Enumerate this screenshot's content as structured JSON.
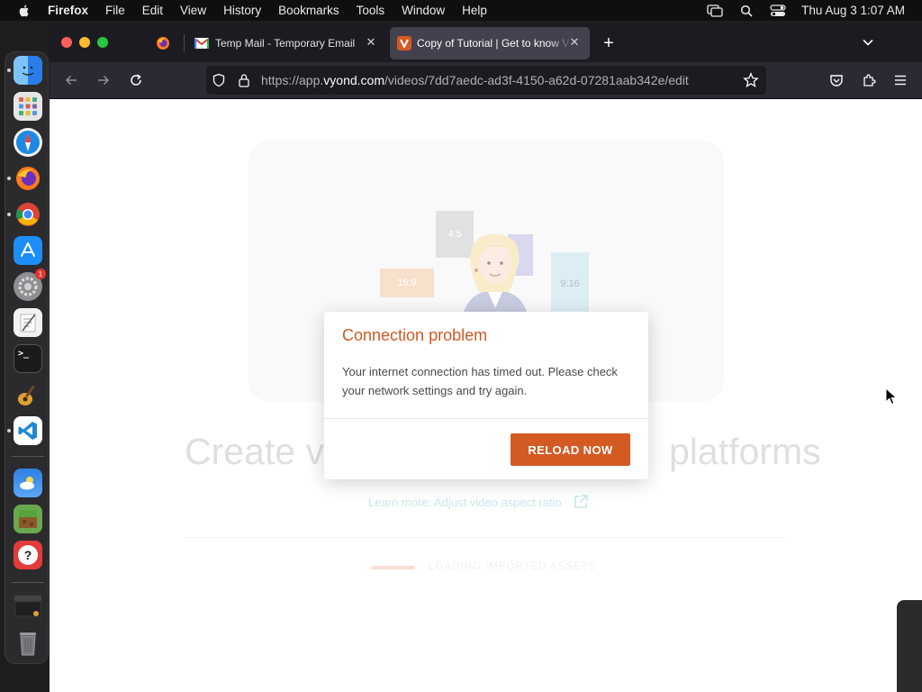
{
  "menubar": {
    "app_name": "Firefox",
    "menus": [
      "File",
      "Edit",
      "View",
      "History",
      "Bookmarks",
      "Tools",
      "Window",
      "Help"
    ],
    "clock": "Thu Aug 3  1:07 AM"
  },
  "dock": {
    "apps": [
      {
        "name": "finder",
        "color": "#3a8ef1"
      },
      {
        "name": "launchpad",
        "color": "#d9d9d9"
      },
      {
        "name": "safari",
        "color": "#1e88e5"
      },
      {
        "name": "firefox",
        "color": "#ff7a1a"
      },
      {
        "name": "chrome",
        "color": "#ffffff"
      },
      {
        "name": "app-store",
        "color": "#1c8ef9"
      },
      {
        "name": "system-settings",
        "color": "#8e8e93",
        "badge": "1"
      },
      {
        "name": "textedit",
        "color": "#f2f2f2"
      },
      {
        "name": "terminal",
        "color": "#1b1b1b",
        "glyph": ">_"
      },
      {
        "name": "garageband",
        "color": "#3b3b3b"
      },
      {
        "name": "vscode",
        "color": "#1f8ad2"
      },
      {
        "name": "weather",
        "color": "#3d8ee8"
      },
      {
        "name": "minecraft",
        "color": "#6aa84f"
      },
      {
        "name": "tips",
        "color": "#e23b3b",
        "glyph": "?"
      },
      {
        "name": "screenshot-thumbnail",
        "color": "#2e2e2e"
      },
      {
        "name": "trash",
        "color": "#6d6d72"
      }
    ]
  },
  "browser": {
    "tabs": [
      {
        "label": "",
        "icon": "firefox-icon"
      },
      {
        "label": "Temp Mail - Temporary Email",
        "icon": "gmail-icon",
        "close": "✕"
      },
      {
        "label": "Copy of Tutorial | Get to know V",
        "icon": "vyond-icon",
        "close": "✕",
        "active": true
      }
    ],
    "new_tab": "+",
    "url_prefix": "https://app.",
    "url_host": "vyond.com",
    "url_path": "/videos/7dd7aedc-ad3f-4150-a62d-07281aab342e/edit"
  },
  "page": {
    "aspect_labels": [
      "4:5",
      "16:9",
      "9:16"
    ],
    "headline_left": "Create v",
    "headline_right": "platforms",
    "learn_more": "Learn more: Adjust video aspect ratio",
    "loading_text": "LOADING IMPORTED ASSETS"
  },
  "modal": {
    "title": "Connection problem",
    "body": "Your internet connection has timed out. Please check your network settings and try again.",
    "button": "RELOAD NOW"
  },
  "colors": {
    "accent": "#d45a23",
    "title": "#cf5a23",
    "link": "#9ad3dd"
  }
}
